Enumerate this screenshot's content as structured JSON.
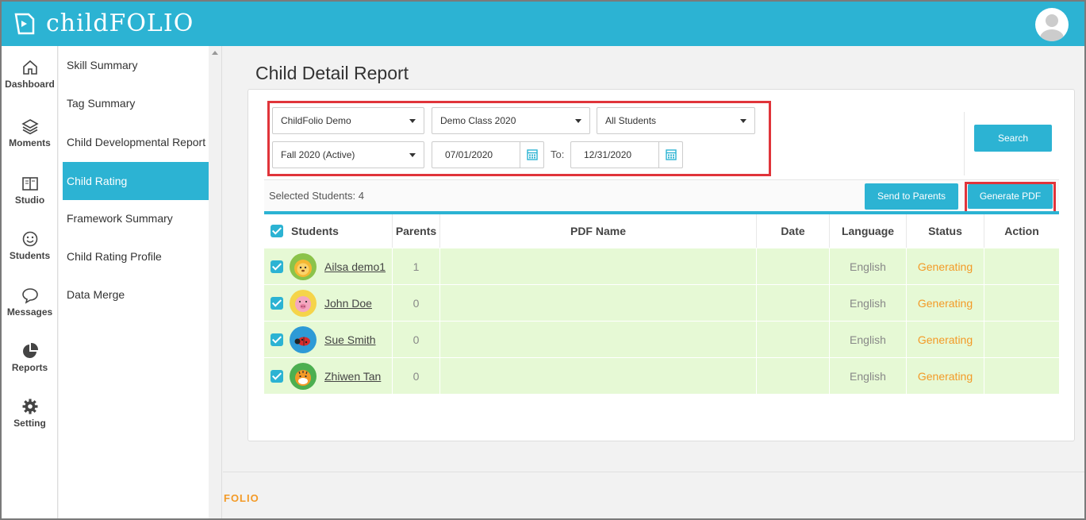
{
  "app": {
    "logo_text": "childFOLIO"
  },
  "leftnav": [
    {
      "label": "Dashboard",
      "icon": "home-icon"
    },
    {
      "label": "Moments",
      "icon": "layers-icon"
    },
    {
      "label": "Studio",
      "icon": "book-icon"
    },
    {
      "label": "Students",
      "icon": "smile-icon"
    },
    {
      "label": "Messages",
      "icon": "chat-icon"
    },
    {
      "label": "Reports",
      "icon": "pie-icon"
    },
    {
      "label": "Setting",
      "icon": "gear-icon"
    }
  ],
  "submenu": [
    {
      "label": "Skill Summary"
    },
    {
      "label": "Tag Summary"
    },
    {
      "label": "Child Developmental Report"
    },
    {
      "label": "Child Rating",
      "active": true
    },
    {
      "label": "Framework Summary"
    },
    {
      "label": "Child Rating Profile"
    },
    {
      "label": "Data Merge"
    }
  ],
  "page": {
    "title": "Child Detail Report"
  },
  "filters": {
    "school": "ChildFolio Demo",
    "class": "Demo Class 2020",
    "students": "All Students",
    "term": "Fall 2020 (Active)",
    "date_from": "07/01/2020",
    "to_label": "To:",
    "date_to": "12/31/2020",
    "search_label": "Search"
  },
  "toolbar": {
    "selected_text": "Selected Students: 4",
    "send_label": "Send to Parents",
    "generate_label": "Generate PDF"
  },
  "table": {
    "headers": [
      "Students",
      "Parents",
      "PDF Name",
      "Date",
      "Language",
      "Status",
      "Action"
    ],
    "rows": [
      {
        "name": "Ailsa demo1",
        "parents": "1",
        "pdf": "",
        "date": "",
        "language": "English",
        "status": "Generating",
        "avatar_color": "#8bc34a"
      },
      {
        "name": "John Doe",
        "parents": "0",
        "pdf": "",
        "date": "",
        "language": "English",
        "status": "Generating",
        "avatar_color": "#f5d44a"
      },
      {
        "name": "Sue Smith",
        "parents": "0",
        "pdf": "",
        "date": "",
        "language": "English",
        "status": "Generating",
        "avatar_color": "#2e9ad6"
      },
      {
        "name": "Zhiwen Tan",
        "parents": "0",
        "pdf": "",
        "date": "",
        "language": "English",
        "status": "Generating",
        "avatar_color": "#4caf50"
      }
    ]
  },
  "footer": {
    "logo_text": "FOLIO"
  },
  "colors": {
    "accent": "#2cb3d3",
    "highlight": "#e0343a",
    "status_generating": "#f39a27",
    "row_bg": "#e6f9d5"
  }
}
